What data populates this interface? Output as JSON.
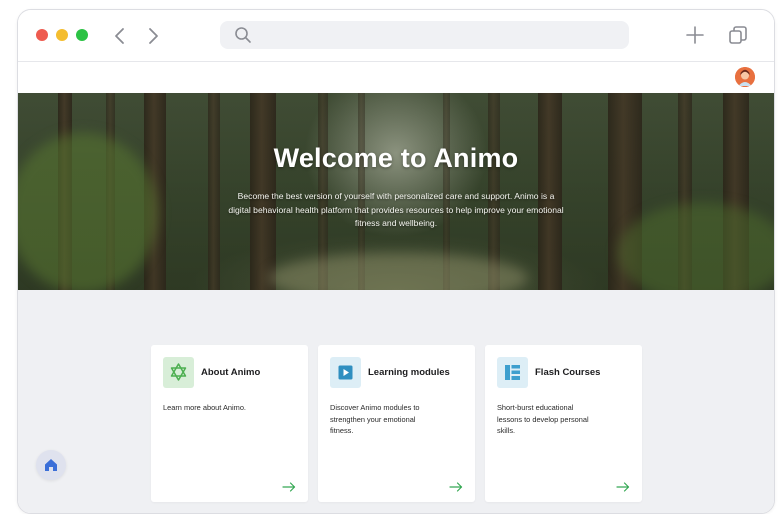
{
  "browser": {
    "url_value": "",
    "icons": {
      "search": "search-icon",
      "back": "chevron-left-icon",
      "forward": "chevron-right-icon",
      "new_tab": "plus-icon",
      "tabs": "copy-icon"
    }
  },
  "header": {
    "avatar": "user-avatar"
  },
  "hero": {
    "title": "Welcome to Animo",
    "subtitle": "Become the best version of yourself with personalized care and support. Animo is a digital behavioral health platform that provides resources to help improve your emotional fitness and wellbeing."
  },
  "cards": [
    {
      "title": "About Animo",
      "description": "Learn more about Animo.",
      "icon": "star-of-david-icon",
      "badge_color": "#d8eed8",
      "icon_color": "#4caf50"
    },
    {
      "title": "Learning modules",
      "description": "Discover Animo modules to strengthen your emotional fitness.",
      "icon": "play-icon",
      "badge_color": "#ddeef6",
      "icon_color": "#2f8fc0"
    },
    {
      "title": "Flash Courses",
      "description": "Short-burst educational lessons to develop personal skills.",
      "icon": "layout-icon",
      "badge_color": "#ddeef6",
      "icon_color": "#3d9fce"
    }
  ],
  "colors": {
    "arrow": "#34a853",
    "home_icon": "#3b6fd8",
    "content_bg": "#eff0f3"
  }
}
